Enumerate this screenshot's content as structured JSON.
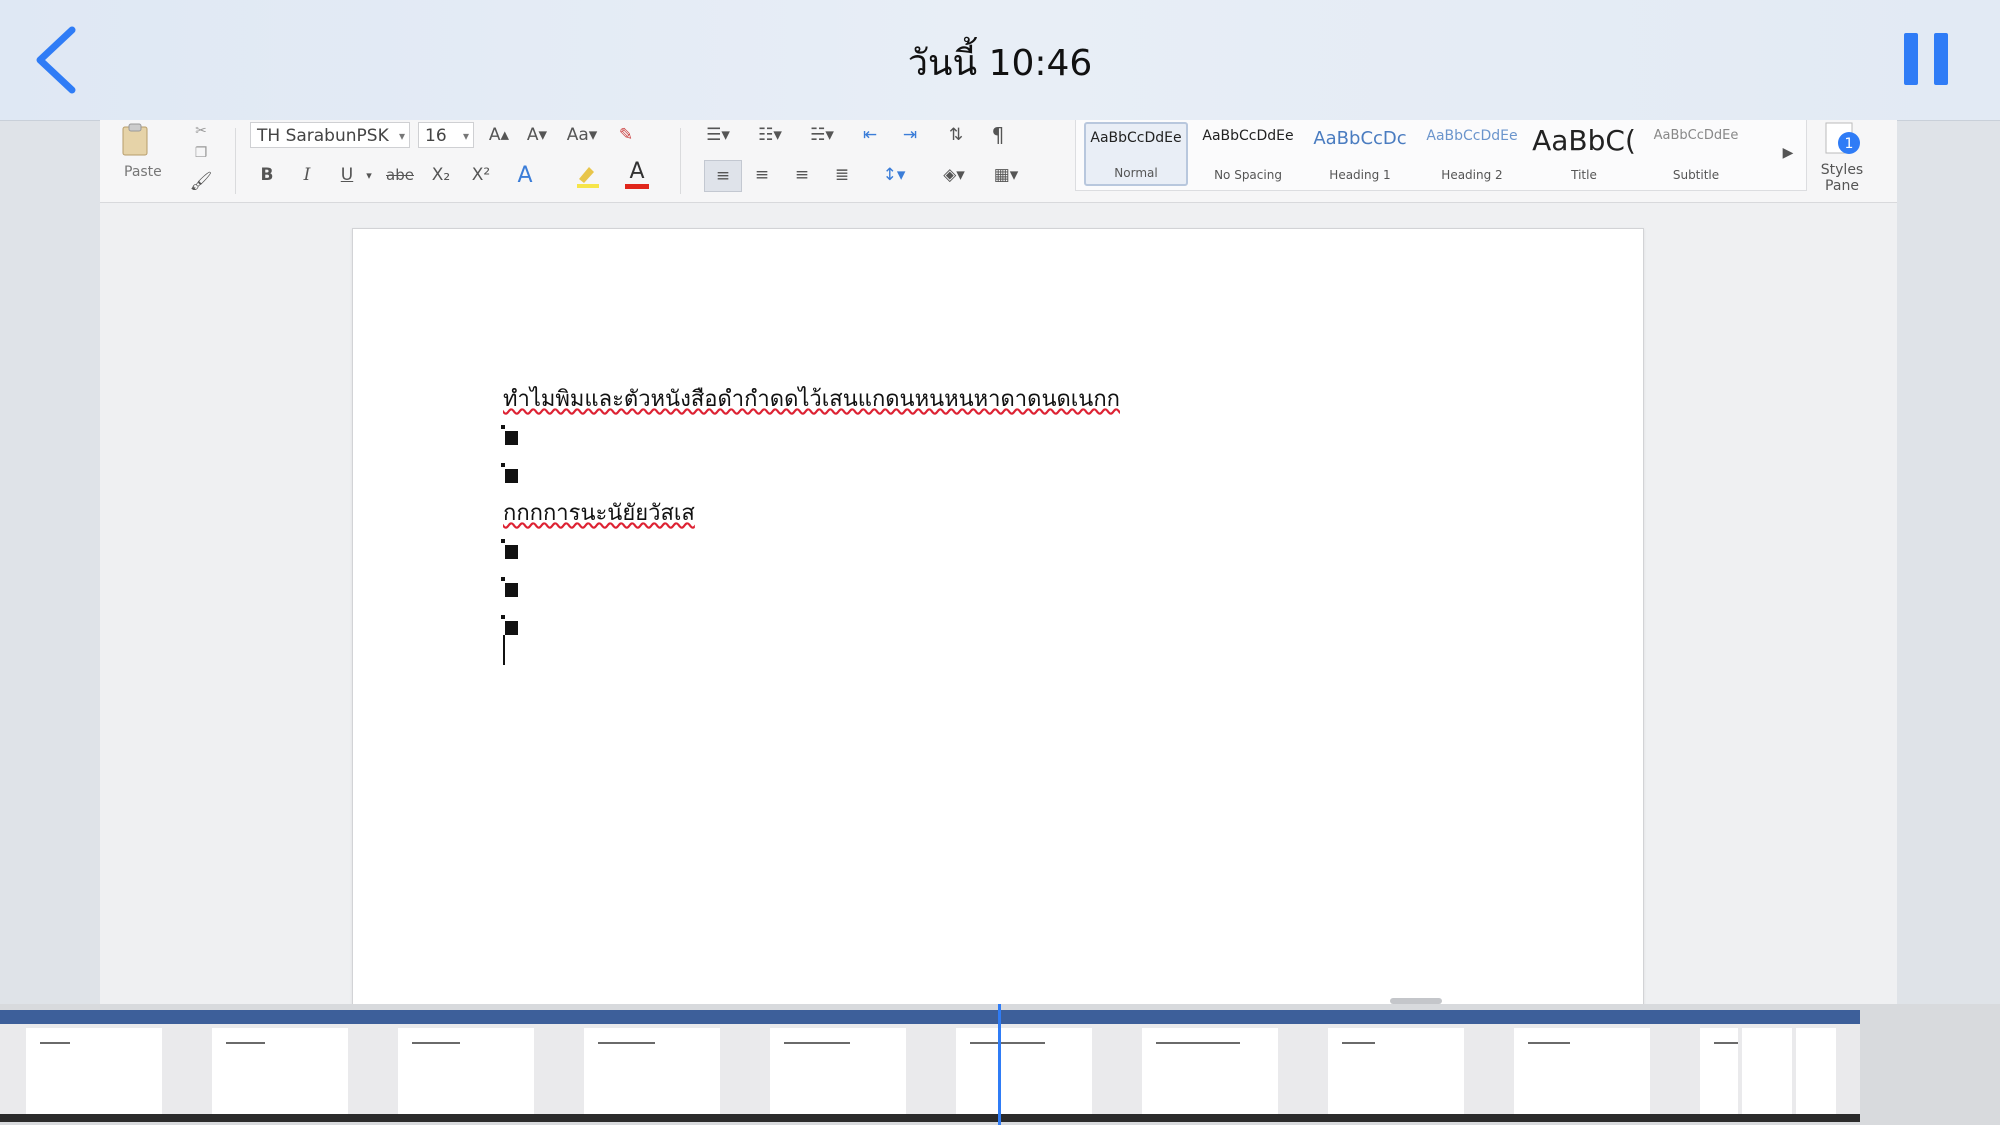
{
  "nav": {
    "title": "วันนี้ 10:46",
    "back_icon": "chevron-left-icon",
    "pause_icon": "pause-icon",
    "accent": "#2f7cf6"
  },
  "ribbon": {
    "paste_label": "Paste",
    "font_name": "TH SarabunPSK",
    "font_size": "16",
    "bold": "B",
    "italic": "I",
    "underline": "U",
    "strike": "abe",
    "subscript": "X₂",
    "superscript": "X²",
    "grow_font": "A▴",
    "shrink_font": "A▾",
    "font_color_letter": "A",
    "text_effects_letter": "A",
    "styles_pane_label": "Styles Pane",
    "styles": [
      {
        "preview": "AaBbCcDdEe",
        "name": "Normal"
      },
      {
        "preview": "AaBbCcDdEe",
        "name": "No Spacing"
      },
      {
        "preview": "AaBbCcDc",
        "name": "Heading 1"
      },
      {
        "preview": "AaBbCcDdEe",
        "name": "Heading 2"
      },
      {
        "preview": "AaBbC(",
        "name": "Title"
      },
      {
        "preview": "AaBbCcDdEe",
        "name": "Subtitle"
      }
    ]
  },
  "document": {
    "line1": "ทำไมพิมและตัวหนังสือดำกำดดไว้เสนแกดนหนหนหาดาดนดเนกก",
    "line2": "กกกการนะนัยัยวัสเส"
  },
  "filmstrip": {
    "thumb_count": 10
  }
}
